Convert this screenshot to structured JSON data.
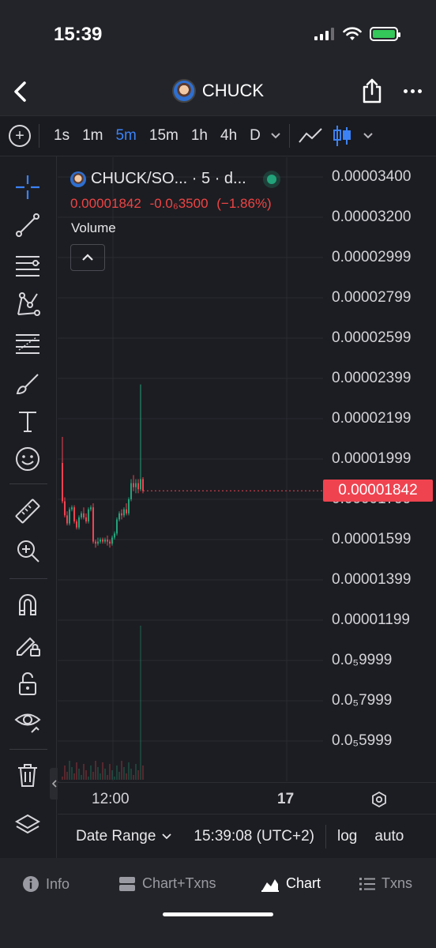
{
  "status_bar": {
    "time": "15:39"
  },
  "header": {
    "title": "CHUCK"
  },
  "toolbar": {
    "timeframes": [
      {
        "label": "1s",
        "active": false
      },
      {
        "label": "1m",
        "active": false
      },
      {
        "label": "5m",
        "active": true
      },
      {
        "label": "15m",
        "active": false
      },
      {
        "label": "1h",
        "active": false
      },
      {
        "label": "4h",
        "active": false
      },
      {
        "label": "D",
        "active": false
      }
    ]
  },
  "legend": {
    "pair": "CHUCK/SO... · 5 · d...",
    "price": "0.00001842",
    "change": "-0.0₆3500",
    "change_pct": "(−1.86%)",
    "volume_label": "Volume"
  },
  "price_axis": {
    "labels": [
      "0.00003400",
      "0.00003200",
      "0.00002999",
      "0.00002799",
      "0.00002599",
      "0.00002399",
      "0.00002199",
      "0.00001999",
      "0.00001799",
      "0.00001599",
      "0.00001399",
      "0.00001199",
      "0.0₅9999",
      "0.0₅7999",
      "0.0₅5999"
    ],
    "current_price": "0.00001842"
  },
  "time_axis": {
    "labels": [
      "12:00",
      "17"
    ]
  },
  "bottom_controls": {
    "date_range_label": "Date Range",
    "time_display": "15:39:08 (UTC+2)",
    "log_label": "log",
    "auto_label": "auto"
  },
  "bottom_nav": {
    "items": [
      {
        "label": "Info",
        "icon": "info-icon"
      },
      {
        "label": "Chart+Txns",
        "icon": "split-view-icon"
      },
      {
        "label": "Chart",
        "icon": "chart-icon",
        "active": true
      },
      {
        "label": "Txns",
        "icon": "list-icon"
      }
    ]
  },
  "colors": {
    "accent": "#3b82f6",
    "up": "#22a37a",
    "down": "#ef4350",
    "background": "#1c1d22"
  },
  "chart_data": {
    "type": "candlestick",
    "title": "CHUCK/SO... · 5 · d...",
    "ylim": [
      5e-06,
      3.5e-05
    ],
    "grid": true,
    "current_price": 1.842e-05,
    "candles": [
      {
        "o": 1.98e-05,
        "h": 2.11e-05,
        "l": 1.78e-05,
        "c": 1.79e-05
      },
      {
        "o": 1.79e-05,
        "h": 1.81e-05,
        "l": 1.71e-05,
        "c": 1.72e-05
      },
      {
        "o": 1.72e-05,
        "h": 1.74e-05,
        "l": 1.67e-05,
        "c": 1.68e-05
      },
      {
        "o": 1.68e-05,
        "h": 1.76e-05,
        "l": 1.67e-05,
        "c": 1.75e-05
      },
      {
        "o": 1.75e-05,
        "h": 1.77e-05,
        "l": 1.74e-05,
        "c": 1.76e-05
      },
      {
        "o": 1.76e-05,
        "h": 1.77e-05,
        "l": 1.68e-05,
        "c": 1.69e-05
      },
      {
        "o": 1.69e-05,
        "h": 1.7e-05,
        "l": 1.65e-05,
        "c": 1.66e-05
      },
      {
        "o": 1.66e-05,
        "h": 1.72e-05,
        "l": 1.65e-05,
        "c": 1.71e-05
      },
      {
        "o": 1.71e-05,
        "h": 1.74e-05,
        "l": 1.7e-05,
        "c": 1.73e-05
      },
      {
        "o": 1.73e-05,
        "h": 1.76e-05,
        "l": 1.7e-05,
        "c": 1.71e-05
      },
      {
        "o": 1.71e-05,
        "h": 1.73e-05,
        "l": 1.68e-05,
        "c": 1.69e-05
      },
      {
        "o": 1.69e-05,
        "h": 1.76e-05,
        "l": 1.68e-05,
        "c": 1.75e-05
      },
      {
        "o": 1.75e-05,
        "h": 1.77e-05,
        "l": 1.74e-05,
        "c": 1.76e-05
      },
      {
        "o": 1.76e-05,
        "h": 1.78e-05,
        "l": 1.58e-05,
        "c": 1.59e-05
      },
      {
        "o": 1.59e-05,
        "h": 1.6e-05,
        "l": 1.56e-05,
        "c": 1.58e-05
      },
      {
        "o": 1.58e-05,
        "h": 1.61e-05,
        "l": 1.57e-05,
        "c": 1.59e-05
      },
      {
        "o": 1.59e-05,
        "h": 1.61e-05,
        "l": 1.58e-05,
        "c": 1.6e-05
      },
      {
        "o": 1.6e-05,
        "h": 1.61e-05,
        "l": 1.58e-05,
        "c": 1.59e-05
      },
      {
        "o": 1.59e-05,
        "h": 1.61e-05,
        "l": 1.58e-05,
        "c": 1.6e-05
      },
      {
        "o": 1.6e-05,
        "h": 1.62e-05,
        "l": 1.57e-05,
        "c": 1.59e-05
      },
      {
        "o": 1.59e-05,
        "h": 1.6e-05,
        "l": 1.56e-05,
        "c": 1.58e-05
      },
      {
        "o": 1.58e-05,
        "h": 1.62e-05,
        "l": 1.57e-05,
        "c": 1.61e-05
      },
      {
        "o": 1.61e-05,
        "h": 1.64e-05,
        "l": 1.6e-05,
        "c": 1.63e-05
      },
      {
        "o": 1.63e-05,
        "h": 1.71e-05,
        "l": 1.62e-05,
        "c": 1.7e-05
      },
      {
        "o": 1.7e-05,
        "h": 1.74e-05,
        "l": 1.69e-05,
        "c": 1.73e-05
      },
      {
        "o": 1.73e-05,
        "h": 1.75e-05,
        "l": 1.7e-05,
        "c": 1.72e-05
      },
      {
        "o": 1.72e-05,
        "h": 1.76e-05,
        "l": 1.71e-05,
        "c": 1.75e-05
      },
      {
        "o": 1.75e-05,
        "h": 1.78e-05,
        "l": 1.72e-05,
        "c": 1.73e-05
      },
      {
        "o": 1.73e-05,
        "h": 1.81e-05,
        "l": 1.72e-05,
        "c": 1.8e-05
      },
      {
        "o": 1.8e-05,
        "h": 1.9e-05,
        "l": 1.79e-05,
        "c": 1.88e-05
      },
      {
        "o": 1.88e-05,
        "h": 1.92e-05,
        "l": 1.84e-05,
        "c": 1.86e-05
      },
      {
        "o": 1.86e-05,
        "h": 1.9e-05,
        "l": 1.83e-05,
        "c": 1.88e-05
      },
      {
        "o": 1.88e-05,
        "h": 1.9e-05,
        "l": 1.83e-05,
        "c": 1.85e-05
      },
      {
        "o": 1.85e-05,
        "h": 2.37e-05,
        "l": 1.84e-05,
        "c": 1.9e-05
      },
      {
        "o": 1.9e-05,
        "h": 1.91e-05,
        "l": 1.83e-05,
        "c": 1.842e-05
      }
    ]
  }
}
